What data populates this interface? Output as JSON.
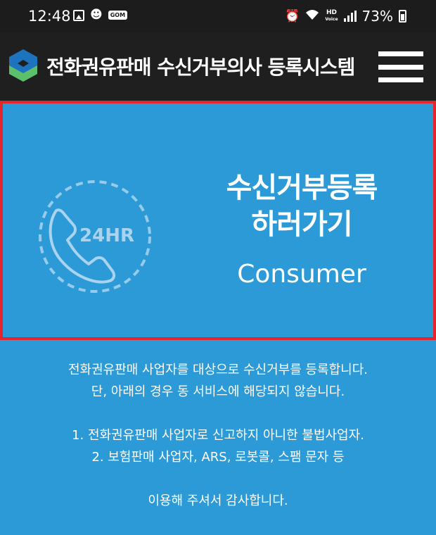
{
  "status_bar": {
    "time": "12:48",
    "notification_icons": [
      "gallery-icon",
      "person-icon",
      "gom-icon"
    ],
    "gom_label": "GOM",
    "system_icons": [
      "alarm-icon",
      "wifi-icon",
      "hd-voice-icon",
      "signal-icon",
      "battery-icon"
    ],
    "hd_label": "HD",
    "voice_label": "Voice",
    "battery_percent": "73%"
  },
  "header": {
    "title": "전화권유판매 수신거부의사 등록시스템",
    "logo_colors": [
      "#1e73be",
      "#5cc06b",
      "#2a4f7a"
    ],
    "menu_icon": "hamburger-menu-icon"
  },
  "hero": {
    "badge_text": "24HR",
    "icon": "phone-icon",
    "title_line1": "수신거부등록",
    "title_line2": "하러가기",
    "subtitle": "Consumer",
    "background_color": "#2b9ad6",
    "highlight_border_color": "#e4262c"
  },
  "notice": {
    "line1": "전화권유판매 사업자를 대상으로 수신거부를 등록합니다.",
    "line2": "단, 아래의 경우 동 서비스에 해당되지 않습니다.",
    "item1": "1. 전화권유판매 사업자로 신고하지 아니한 불법사업자.",
    "item2": "2. 보험판매 사업자, ARS, 로봇콜, 스팸 문자 등",
    "closing": "이용해 주셔서 감사합니다."
  }
}
